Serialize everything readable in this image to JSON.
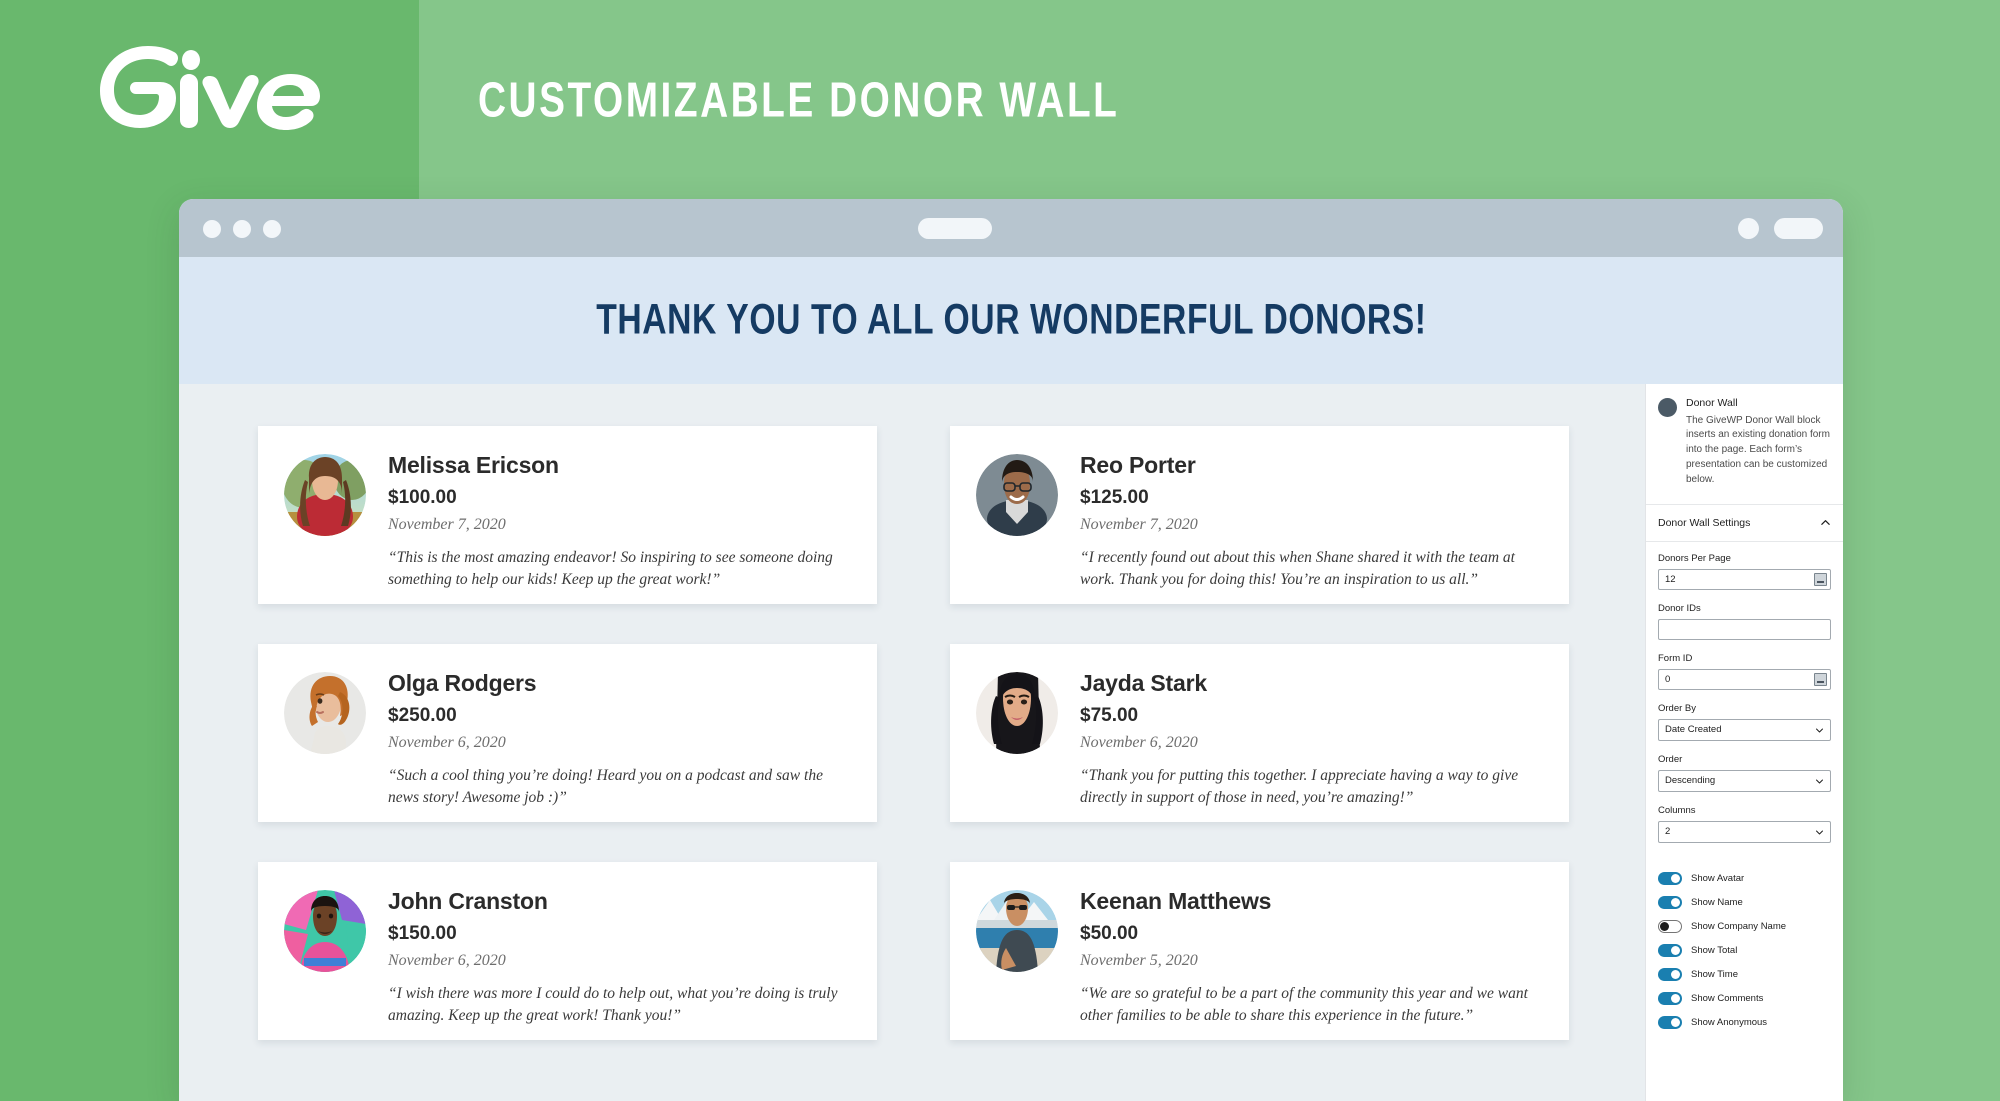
{
  "banner": {
    "logo_text": "Give",
    "title": "CUSTOMIZABLE DONOR WALL"
  },
  "browser": {
    "dots": [
      "red-dot",
      "yellow-dot",
      "green-dot"
    ]
  },
  "hero": {
    "title": "THANK YOU TO ALL OUR WONDERFUL DONORS!"
  },
  "donors": [
    {
      "name": "Melissa Ericson",
      "amount": "$100.00",
      "date": "November 7, 2020",
      "comment": "“This is the most amazing endeavor! So inspiring to see someone doing something to help our kids! Keep up the great work!”"
    },
    {
      "name": "Reo Porter",
      "amount": "$125.00",
      "date": "November 7, 2020",
      "comment": "“I recently found out about this when Shane shared it with the team at work. Thank you for doing this! You’re an inspiration to us all.”"
    },
    {
      "name": "Olga Rodgers",
      "amount": "$250.00",
      "date": "November 6, 2020",
      "comment": "“Such a cool thing you’re doing! Heard you on a podcast and saw the news story! Awesome job :)”"
    },
    {
      "name": "Jayda Stark",
      "amount": "$75.00",
      "date": "November 6, 2020",
      "comment": "“Thank you for putting this together. I appreciate having a way to give directly in support of those in need, you’re amazing!”"
    },
    {
      "name": "John Cranston",
      "amount": "$150.00",
      "date": "November 6, 2020",
      "comment": "“I wish there was more I could do to help out, what you’re doing is truly amazing. Keep up the great work! Thank you!”"
    },
    {
      "name": "Keenan Matthews",
      "amount": "$50.00",
      "date": "November 5, 2020",
      "comment": "“We are so grateful to be a part of the community this year and we want other families to be able to share this experience in the future.”"
    }
  ],
  "settings": {
    "block": {
      "title": "Donor Wall",
      "description": "The GiveWP Donor Wall block inserts an existing donation form into the page. Each form’s presentation can be customized below."
    },
    "section": {
      "title": "Donor Wall Settings",
      "collapse_icon": "chevron-up-icon"
    },
    "fields": [
      {
        "label": "Donors Per Page",
        "value": "12",
        "type": "number",
        "placeholder": ""
      },
      {
        "label": "Donor IDs",
        "value": "",
        "type": "text",
        "placeholder": ""
      },
      {
        "label": "Form ID",
        "value": "0",
        "type": "number",
        "placeholder": ""
      },
      {
        "label": "Order By",
        "value": "Date Created",
        "type": "select",
        "placeholder": ""
      },
      {
        "label": "Order",
        "value": "Descending",
        "type": "select",
        "placeholder": ""
      },
      {
        "label": "Columns",
        "value": "2",
        "type": "select",
        "placeholder": ""
      }
    ],
    "toggles": [
      {
        "label": "Show Avatar",
        "on": true
      },
      {
        "label": "Show Name",
        "on": true
      },
      {
        "label": "Show Company Name",
        "on": false
      },
      {
        "label": "Show Total",
        "on": true
      },
      {
        "label": "Show Time",
        "on": true
      },
      {
        "label": "Show Comments",
        "on": true
      },
      {
        "label": "Show Anonymous",
        "on": true
      }
    ]
  },
  "colors": {
    "brand_green_dark": "#69b86d",
    "brand_green_light": "#85c68a",
    "hero_blue_bg": "#dae7f4",
    "hero_title": "#153b63",
    "page_bg": "#eaeff2",
    "toggle_on": "#1a7fb0",
    "chrome": "#b7c5cf"
  }
}
